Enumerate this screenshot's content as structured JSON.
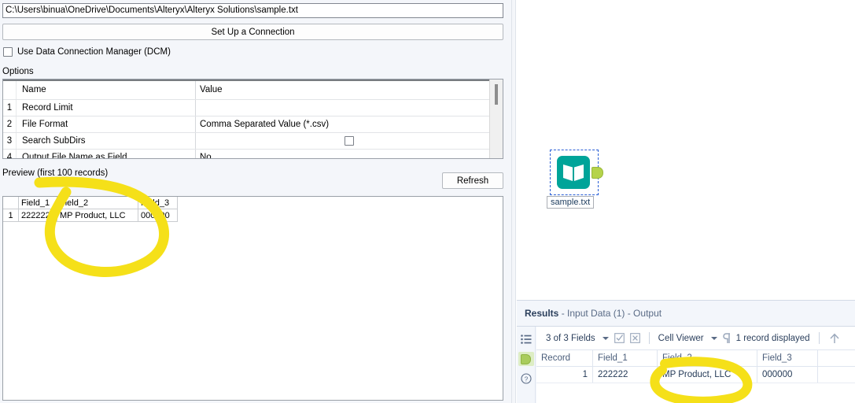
{
  "config_panel": {
    "file_path": "C:\\Users\\binua\\OneDrive\\Documents\\Alteryx\\Alteryx Solutions\\sample.txt",
    "setup_connection_label": "Set Up a Connection",
    "dcm_checkbox_label": "Use Data Connection Manager (DCM)",
    "dcm_checked": false,
    "options_label": "Options",
    "options_table": {
      "headers": [
        "",
        "Name",
        "Value"
      ],
      "rows": [
        {
          "num": "1",
          "name": "Record Limit",
          "value": "",
          "control": "text"
        },
        {
          "num": "2",
          "name": "File Format",
          "value": "Comma Separated Value (*.csv)",
          "control": "dropdown"
        },
        {
          "num": "3",
          "name": "Search SubDirs",
          "value": "",
          "control": "checkbox"
        },
        {
          "num": "4",
          "name": "Output File Name as Field",
          "value": "No",
          "control": "dropdown"
        }
      ]
    },
    "preview_label": "Preview (first 100 records)",
    "refresh_label": "Refresh",
    "preview_table": {
      "headers": [
        "Field_1",
        "Field_2",
        "Field_3"
      ],
      "rows": [
        {
          "num": "1",
          "cells": [
            "222222",
            "MP Product, LLC",
            "000000"
          ]
        }
      ]
    }
  },
  "canvas": {
    "tool_name": "sample.txt",
    "tool_icon": "input-data-book-icon",
    "tool_color": "#00a499",
    "anchor_color": "#b5d34b",
    "selected": true
  },
  "results": {
    "title_bold": "Results",
    "title_rest": " - Input Data (1) - Output",
    "rail": [
      {
        "icon": "list-view-icon",
        "name": "messages-list"
      },
      {
        "icon": "output-anchor-icon",
        "name": "output-anchor",
        "active": true
      },
      {
        "icon": "help-circle-icon",
        "name": "help"
      }
    ],
    "toolbar": {
      "fields_label": "3 of 3 Fields",
      "select_all_icon": "checkbox-checked-icon",
      "deselect_all_icon": "checkbox-x-icon",
      "cell_viewer_label": "Cell Viewer",
      "pilcrow_icon": "pilcrow-icon",
      "record_count_label": "1 record displayed",
      "expand_icon": "arrow-up-icon"
    },
    "grid": {
      "headers": [
        "Record",
        "Field_1",
        "Field_2",
        "Field_3"
      ],
      "rows": [
        {
          "cells": [
            "1",
            "222222",
            "MP Product, LLC",
            "000000"
          ]
        }
      ]
    }
  },
  "annotations": {
    "highlight_color": "#f5e019",
    "marks": [
      {
        "name": "preview-field-highlight-circle",
        "shape": "hand-drawn-oval"
      },
      {
        "name": "results-field2-highlight-circle",
        "shape": "hand-drawn-oval"
      }
    ]
  }
}
